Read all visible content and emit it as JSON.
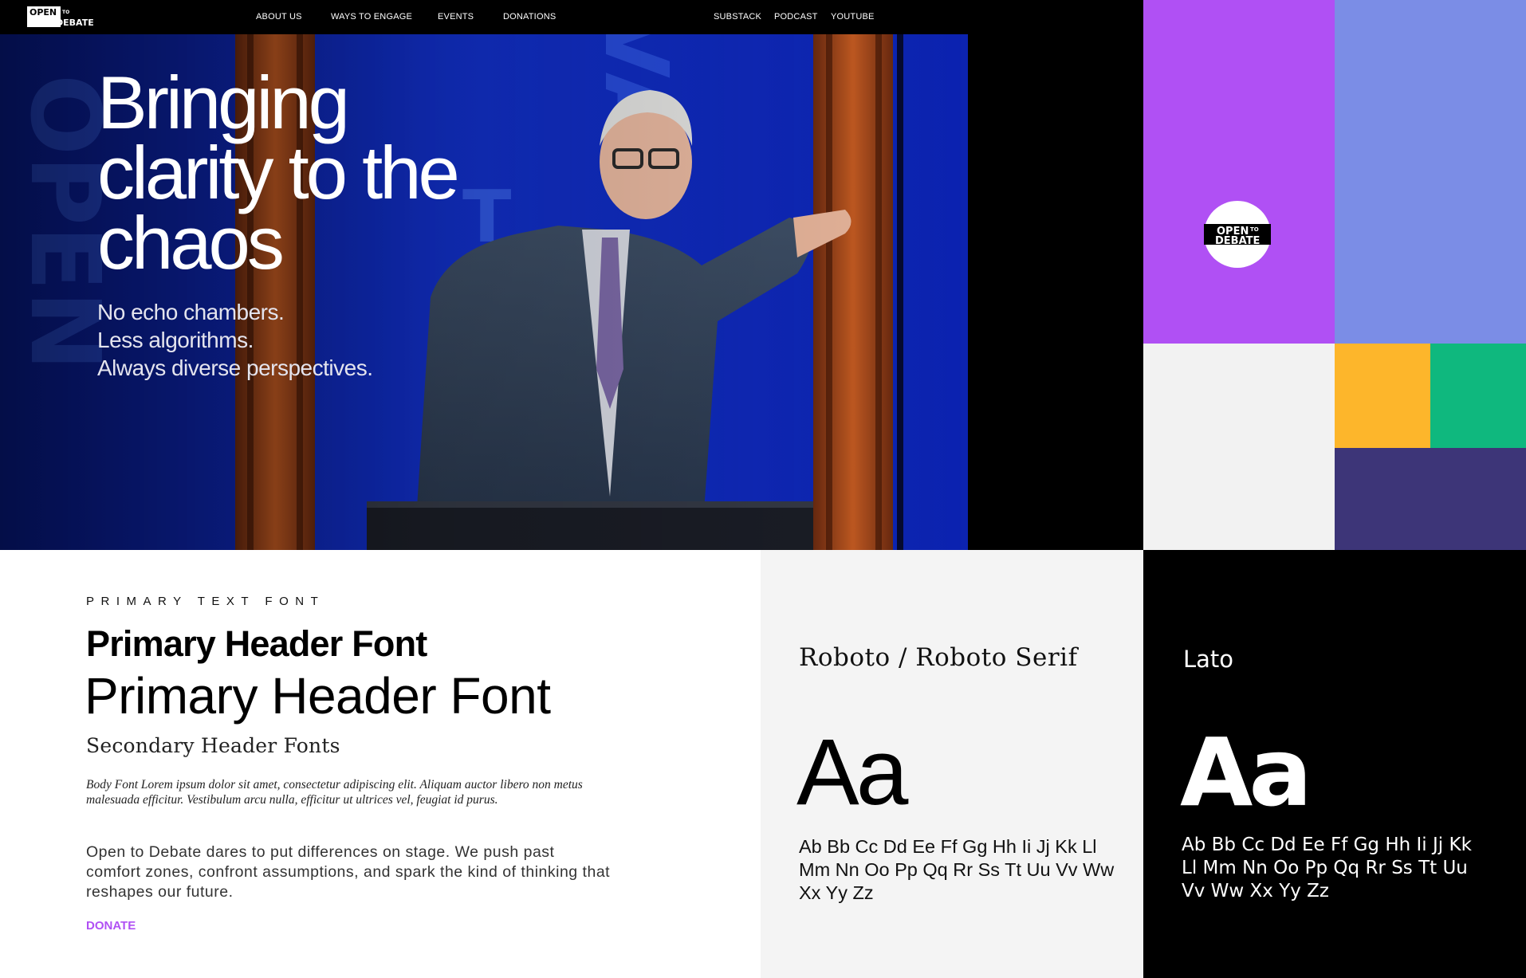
{
  "logo": {
    "text_top": "OPEN",
    "text_small": "TO",
    "text_bottom": "DEBATE"
  },
  "nav": {
    "left": [
      {
        "label": "ABOUT US"
      },
      {
        "label": "WAYS TO ENGAGE"
      },
      {
        "label": "EVENTS"
      },
      {
        "label": "DONATIONS"
      }
    ],
    "right": [
      {
        "label": "SUBSTACK"
      },
      {
        "label": "PODCAST"
      },
      {
        "label": "YOUTUBE"
      }
    ]
  },
  "hero": {
    "title_lines": [
      "Bringing",
      "clarity to the",
      "chaos"
    ],
    "sub_lines": [
      "No echo chambers.",
      "Less algorithms.",
      "Always diverse perspectives."
    ]
  },
  "palette": {
    "purple": "#b050f4",
    "periwinkle": "#7b8de6",
    "light_gray": "#f2f2f2",
    "yellow": "#fdb62b",
    "green": "#0fb87e",
    "indigo": "#3d3578",
    "black": "#000000"
  },
  "typography": {
    "label": "PRIMARY TEXT FONT",
    "header_bold": "Primary Header Font",
    "header_light": "Primary Header Font",
    "secondary": "Secondary Header Fonts",
    "body_serif": "Body Font Lorem ipsum dolor sit amet, consectetur adipiscing elit. Aliquam auctor libero non metus malesuada efficitur. Vestibulum arcu nulla, efficitur ut ultrices vel, feugiat id purus.",
    "body_sans": "Open to Debate dares to put differences on stage. We push past comfort zones, confront assumptions, and spark the kind of thinking that reshapes our future.",
    "cta": "DONATE"
  },
  "specimens": [
    {
      "name": "Roboto / Roboto Serif",
      "sample": "Aa",
      "alphabet": "Ab Bb Cc Dd Ee Ff Gg Hh Ii Jj Kk Ll Mm Nn Oo Pp Qq Rr Ss Tt Uu Vv Ww Xx Yy Zz"
    },
    {
      "name": "Lato",
      "sample": "Aa",
      "alphabet": "Ab Bb Cc Dd Ee Ff Gg Hh Ii Jj Kk Ll Mm Nn Oo Pp Qq Rr Ss Tt Uu Vv Ww Xx Yy Zz"
    }
  ]
}
